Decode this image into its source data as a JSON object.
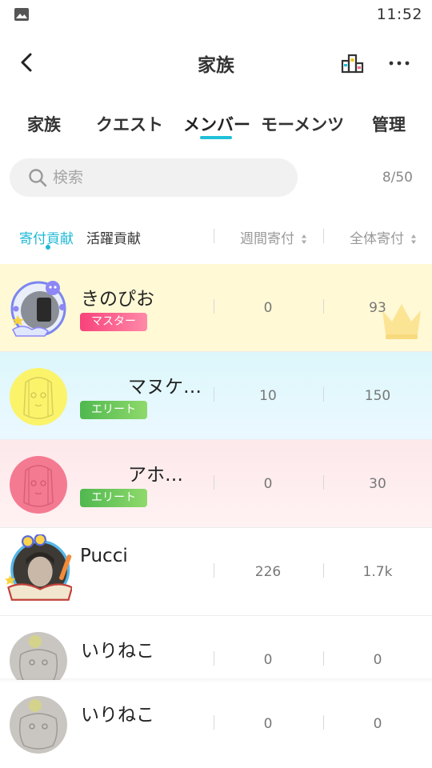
{
  "status_bar": {
    "time": "11:52",
    "notification_icon": "image-icon"
  },
  "header": {
    "title": "家族",
    "back_icon": "back-arrow-icon",
    "ranking_icon": "ranking-podium-icon",
    "more_icon": "more-dots-icon"
  },
  "tabs": [
    {
      "label": "家族",
      "active": false
    },
    {
      "label": "クエスト",
      "active": false
    },
    {
      "label": "メンバー",
      "active": true
    },
    {
      "label": "モーメンツ",
      "active": false
    },
    {
      "label": "管理",
      "active": false
    }
  ],
  "search": {
    "placeholder": "検索",
    "value": "",
    "member_count": "8/50"
  },
  "sort": {
    "tabs": [
      {
        "label": "寄付貢献",
        "active": true
      },
      {
        "label": "活躍貢献",
        "active": false
      }
    ],
    "columns": {
      "weekly": "週間寄付",
      "total": "全体寄付"
    }
  },
  "colors": {
    "accent": "#1ec0d8",
    "master_row": "#fff9d6",
    "elite_blue_row": "#dcf7fb",
    "elite_pink_row": "#fde8ea",
    "master_badge": "#f7427b",
    "elite_badge": "#4fb84f"
  },
  "members": [
    {
      "name": "きのぴお",
      "role": "マスター",
      "weekly": "0",
      "total": "93",
      "crown": true
    },
    {
      "name": "マヌケ…",
      "role": "エリート",
      "weekly": "10",
      "total": "150",
      "crown": false
    },
    {
      "name": "アホ…",
      "role": "エリート",
      "weekly": "0",
      "total": "30",
      "crown": false
    },
    {
      "name": "Pucci",
      "role": "",
      "weekly": "226",
      "total": "1.7k",
      "crown": false
    },
    {
      "name": "いりねこ",
      "role": "",
      "weekly": "0",
      "total": "0",
      "crown": false
    },
    {
      "name": "いりねこ",
      "role": "",
      "weekly": "0",
      "total": "0",
      "crown": false
    }
  ]
}
